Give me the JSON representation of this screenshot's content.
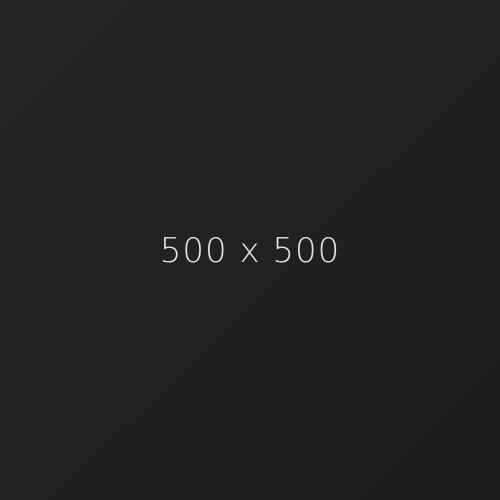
{
  "placeholder": {
    "label": "500 x 500",
    "background_colors": [
      "#262626",
      "#212121",
      "#1c1c1c"
    ],
    "text_color": "#e2e2e2"
  }
}
